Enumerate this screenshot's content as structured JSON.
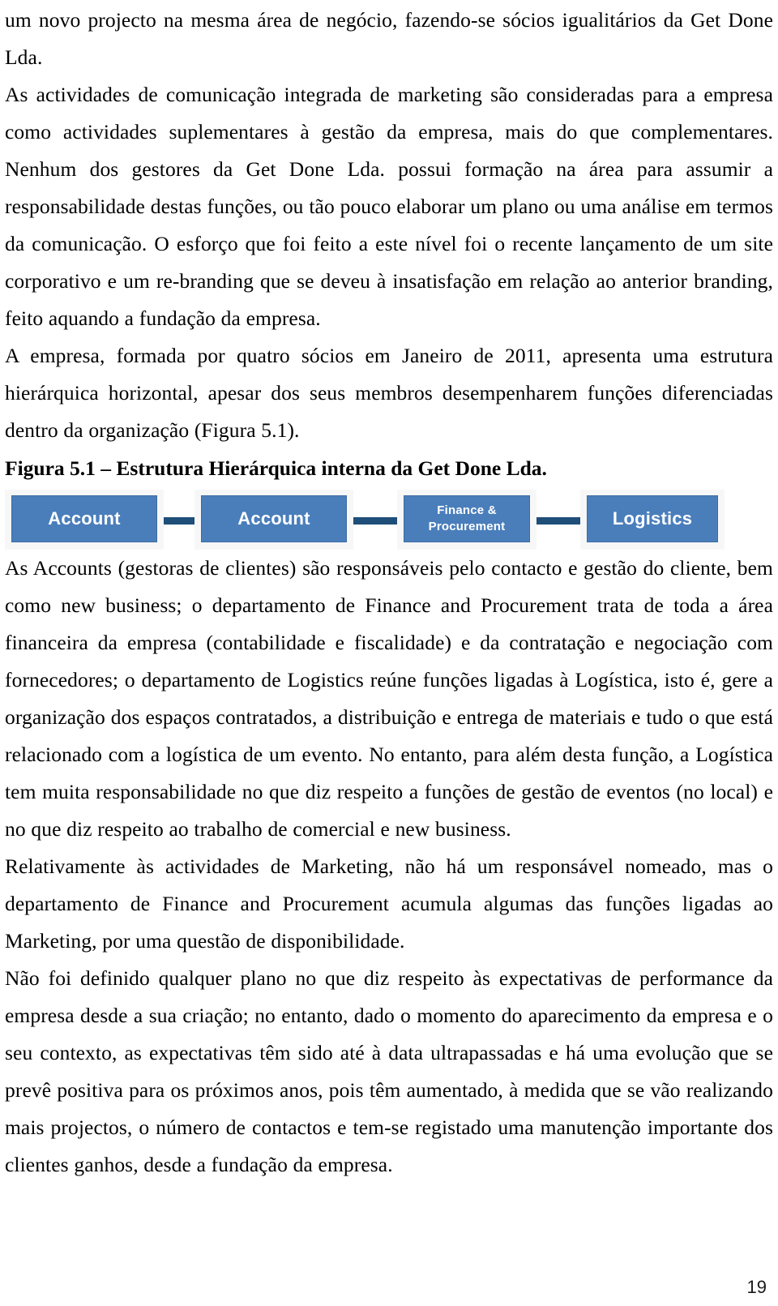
{
  "document": {
    "language": "pt-PT",
    "page_number": "19",
    "paragraphs": [
      "um novo projecto na mesma área de negócio, fazendo-se sócios igualitários da Get Done Lda.",
      "As actividades de comunicação integrada de marketing são consideradas para a empresa como actividades suplementares à gestão da empresa, mais do que complementares. Nenhum dos gestores da Get Done Lda. possui formação na área para assumir a responsabilidade destas funções, ou tão pouco elaborar um plano ou uma análise em termos da comunicação. O esforço que foi feito a este nível foi o recente lançamento de um site corporativo e um re-branding que se deveu à insatisfação em relação ao anterior branding, feito aquando a fundação da empresa.",
      "A empresa, formada por quatro sócios em Janeiro de 2011, apresenta uma estrutura hierárquica horizontal, apesar dos seus membros desempenharem funções diferenciadas dentro da organização (Figura 5.1)."
    ],
    "figure_caption": "Figura 5.1 – Estrutura Hierárquica interna da Get Done Lda.",
    "paragraphs_after_figure": [
      "As Accounts (gestoras de clientes) são responsáveis pelo contacto e gestão do cliente, bem como new business; o departamento de Finance and Procurement trata de toda a área financeira da empresa (contabilidade e fiscalidade) e da contratação e negociação com fornecedores; o departamento de Logistics reúne funções ligadas à Logística, isto é, gere a organização dos espaços contratados, a distribuição e entrega de materiais e tudo o que está relacionado com a logística de um evento. No entanto, para além desta função, a Logística tem muita responsabilidade no que diz respeito a funções de gestão de eventos (no local) e no que diz respeito ao trabalho de comercial e new business.",
      "Relativamente às actividades de Marketing, não há um responsável nomeado, mas o departamento de Finance and Procurement acumula algumas das funções ligadas ao Marketing, por uma questão de disponibilidade.",
      "Não foi definido qualquer plano no que diz respeito às expectativas de performance da empresa desde a sua criação; no entanto, dado o momento do aparecimento da empresa e o seu contexto, as expectativas têm sido até à data ultrapassadas e há uma evolução que se prevê positiva para os próximos anos, pois têm aumentado, à medida que se vão realizando mais projectos, o número de contactos e tem-se registado uma manutenção importante dos clientes ganhos, desde a fundação da empresa."
    ]
  },
  "figure": {
    "id": "figura-5-1",
    "type": "horizontal-hierarchy-chain",
    "colors": {
      "node_fill": "#4a7ebb",
      "node_border": "#3d6ca4",
      "node_frame": "#f7f7f7",
      "connector": "#1f4e79",
      "label_text": "#ffffff"
    },
    "nodes": [
      {
        "label": "Account",
        "lines": [
          "Account"
        ],
        "size": "large"
      },
      {
        "label": "Account",
        "lines": [
          "Account"
        ],
        "size": "large"
      },
      {
        "label": "Finance & Procurement",
        "lines": [
          "Finance &",
          "Procurement"
        ],
        "size": "small"
      },
      {
        "label": "Logistics",
        "lines": [
          "Logistics"
        ],
        "size": "large"
      }
    ],
    "connectors": [
      {
        "from": "Account",
        "to": "Account"
      },
      {
        "from": "Account",
        "to": "Finance & Procurement"
      },
      {
        "from": "Finance & Procurement",
        "to": "Logistics"
      }
    ]
  }
}
